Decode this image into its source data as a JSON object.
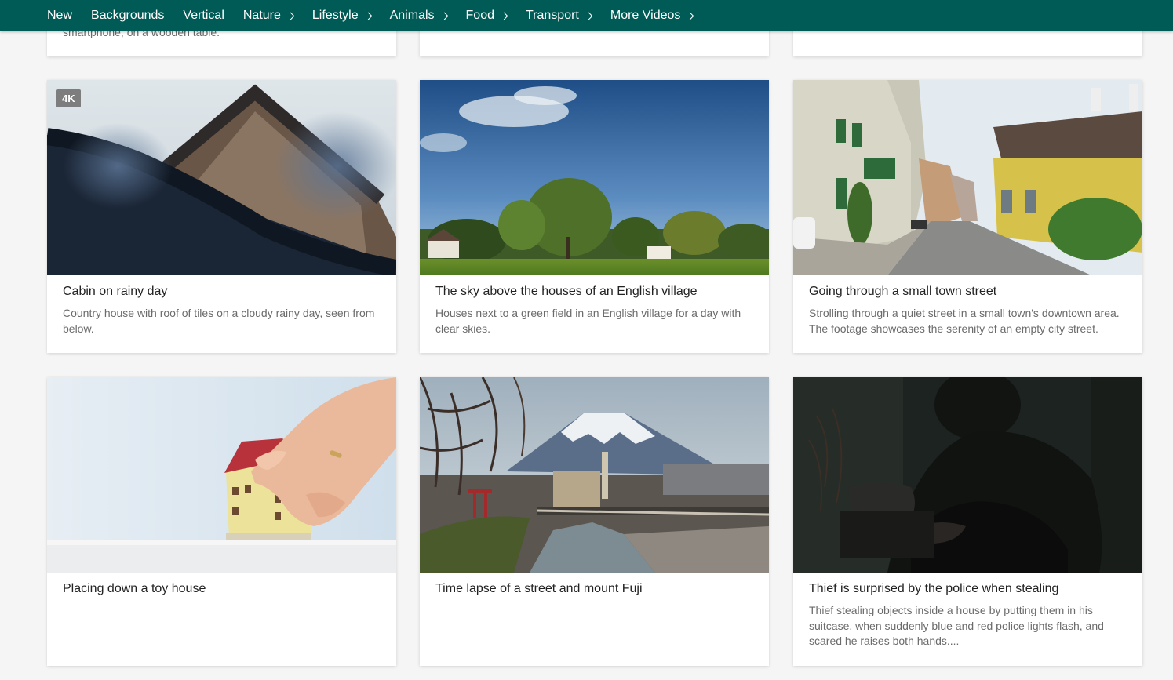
{
  "nav": {
    "items": [
      {
        "label": "New",
        "has_chevron": false
      },
      {
        "label": "Backgrounds",
        "has_chevron": false
      },
      {
        "label": "Vertical",
        "has_chevron": false
      },
      {
        "label": "Nature",
        "has_chevron": true
      },
      {
        "label": "Lifestyle",
        "has_chevron": true
      },
      {
        "label": "Animals",
        "has_chevron": true
      },
      {
        "label": "Food",
        "has_chevron": true
      },
      {
        "label": "Transport",
        "has_chevron": true
      },
      {
        "label": "More Videos",
        "has_chevron": true
      }
    ],
    "chevron_icon": "chevron-right-icon",
    "background": "#005a55"
  },
  "top_row": {
    "partial_desc": "smartphone, on a wooden table."
  },
  "cards": [
    {
      "badge": "4K",
      "title": "Cabin on rainy day",
      "desc": "Country house with roof of tiles on a cloudy rainy day, seen from below."
    },
    {
      "title": "The sky above the houses of an English village",
      "desc": "Houses next to a green field in an English village for a day with clear skies."
    },
    {
      "title": "Going through a small town street",
      "desc": "Strolling through a quiet street in a small town's downtown area. The footage showcases the serenity of an empty city street."
    },
    {
      "title": "Placing down a toy house",
      "desc": ""
    },
    {
      "title": "Time lapse of a street and mount Fuji",
      "desc": ""
    },
    {
      "title": "Thief is surprised by the police when stealing",
      "desc": "Thief stealing objects inside a house by putting them in his suitcase, when suddenly blue and red police lights flash, and scared he raises both hands...."
    }
  ]
}
